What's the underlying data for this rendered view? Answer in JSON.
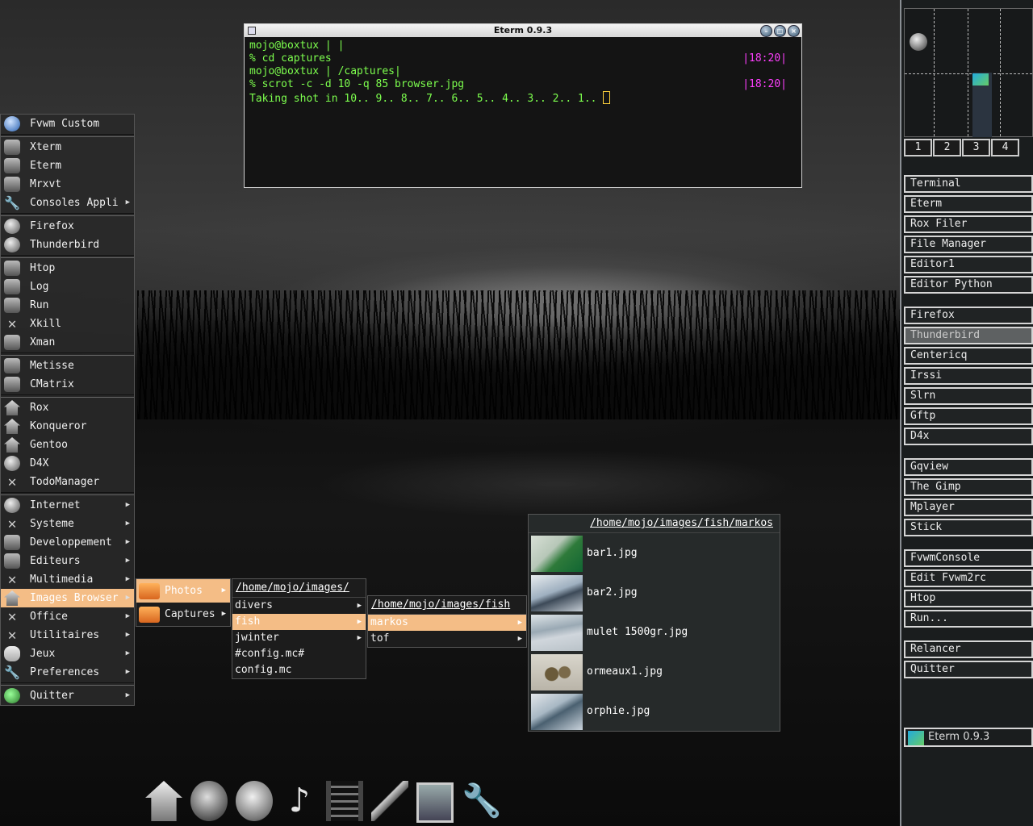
{
  "terminal": {
    "title": "Eterm 0.9.3",
    "lines": [
      {
        "text": "mojo@boxtux | |",
        "time": ""
      },
      {
        "text": "% cd captures",
        "time": "|18:20|"
      },
      {
        "text": "mojo@boxtux | /captures|",
        "time": ""
      },
      {
        "text": "% scrot -c -d 10 -q 85 browser.jpg",
        "time": "|18:20|"
      },
      {
        "text": "Taking shot in 10.. 9.. 8.. 7.. 6.. 5.. 4.. 3.. 2.. 1.. ",
        "time": ""
      }
    ]
  },
  "root_menu": {
    "groups": [
      [
        {
          "label": "Fvwm Custom",
          "icon": "apple-icon",
          "arrow": false
        }
      ],
      [
        {
          "label": "Xterm",
          "icon": "terminal-icon",
          "arrow": false
        },
        {
          "label": "Eterm",
          "icon": "terminal-icon",
          "arrow": false
        },
        {
          "label": "Mrxvt",
          "icon": "terminal-icon",
          "arrow": false
        },
        {
          "label": "Consoles Appli",
          "icon": "wrench-icon",
          "arrow": true
        }
      ],
      [
        {
          "label": "Firefox",
          "icon": "globe-icon",
          "arrow": false
        },
        {
          "label": "Thunderbird",
          "icon": "mail-icon",
          "arrow": false
        }
      ],
      [
        {
          "label": "Htop",
          "icon": "terminal-icon",
          "arrow": false
        },
        {
          "label": "Log",
          "icon": "terminal-icon",
          "arrow": false
        },
        {
          "label": "Run",
          "icon": "terminal-icon",
          "arrow": false
        },
        {
          "label": "Xkill",
          "icon": "x-icon",
          "arrow": false
        },
        {
          "label": "Xman",
          "icon": "book-icon",
          "arrow": false
        }
      ],
      [
        {
          "label": "Metisse",
          "icon": "grid-icon",
          "arrow": false
        },
        {
          "label": "CMatrix",
          "icon": "grid-icon",
          "arrow": false
        }
      ],
      [
        {
          "label": "Rox",
          "icon": "home-icon",
          "arrow": false
        },
        {
          "label": "Konqueror",
          "icon": "home-icon",
          "arrow": false
        },
        {
          "label": "Gentoo",
          "icon": "home-icon",
          "arrow": false
        },
        {
          "label": "D4X",
          "icon": "globe-icon",
          "arrow": false
        },
        {
          "label": "TodoManager",
          "icon": "x-icon",
          "arrow": false
        }
      ],
      [
        {
          "label": "Internet",
          "icon": "globe-icon",
          "arrow": true
        },
        {
          "label": "Systeme",
          "icon": "x-icon",
          "arrow": true
        },
        {
          "label": "Developpement",
          "icon": "book-icon",
          "arrow": true
        },
        {
          "label": "Editeurs",
          "icon": "book-icon",
          "arrow": true
        },
        {
          "label": "Multimedia",
          "icon": "x-icon",
          "arrow": true
        },
        {
          "label": "Images Browser",
          "icon": "home-icon",
          "arrow": true,
          "selected": true
        },
        {
          "label": "Office",
          "icon": "x-icon",
          "arrow": true
        },
        {
          "label": "Utilitaires",
          "icon": "x-icon",
          "arrow": true
        },
        {
          "label": "Jeux",
          "icon": "gamepad-icon",
          "arrow": true
        },
        {
          "label": "Preferences",
          "icon": "wrench-icon",
          "arrow": true
        }
      ],
      [
        {
          "label": "Quitter",
          "icon": "exit-icon",
          "arrow": true
        }
      ]
    ]
  },
  "images_submenu": {
    "items": [
      {
        "label": "Photos",
        "selected": true
      },
      {
        "label": "Captures",
        "selected": false
      }
    ]
  },
  "images_dir_menu": {
    "title": "/home/mojo/images/",
    "items": [
      {
        "label": "divers",
        "arrow": true,
        "selected": false
      },
      {
        "label": "fish",
        "arrow": true,
        "selected": true
      },
      {
        "label": "jwinter",
        "arrow": true,
        "selected": false
      },
      {
        "label": "#config.mc#",
        "arrow": false,
        "selected": false
      },
      {
        "label": "config.mc",
        "arrow": false,
        "selected": false
      }
    ]
  },
  "fish_menu": {
    "title": "/home/mojo/images/fish",
    "items": [
      {
        "label": "markos",
        "arrow": true,
        "selected": true
      },
      {
        "label": "tof",
        "arrow": true,
        "selected": false
      }
    ]
  },
  "markos_menu": {
    "title": "/home/mojo/images/fish/markos",
    "items": [
      {
        "label": "bar1.jpg"
      },
      {
        "label": "bar2.jpg"
      },
      {
        "label": "mulet 1500gr.jpg"
      },
      {
        "label": "ormeaux1.jpg"
      },
      {
        "label": "orphie.jpg"
      }
    ]
  },
  "pager": {
    "desks": [
      "1",
      "2",
      "3",
      "4"
    ]
  },
  "right_panel": {
    "groups": [
      [
        "Terminal",
        "Eterm",
        "Rox Filer",
        "File Manager",
        "Editor1",
        "Editor Python"
      ],
      [
        "Firefox",
        "Thunderbird",
        "Centericq",
        "Irssi",
        "Slrn",
        "Gftp",
        "D4x"
      ],
      [
        "Gqview",
        "The Gimp",
        "Mplayer",
        "Stick"
      ],
      [
        "FvwmConsole",
        "Edit Fvwm2rc",
        "Htop",
        "Run..."
      ],
      [
        "Relancer",
        "Quitter"
      ]
    ],
    "active": "Thunderbird",
    "taskbar_item": "Eterm 0.9.3"
  },
  "dock": {
    "icons": [
      "home-icon",
      "firefox-icon",
      "thunderbird-icon",
      "music-icon",
      "film-icon",
      "pen-icon",
      "monitor-icon",
      "wrench-icon"
    ]
  }
}
